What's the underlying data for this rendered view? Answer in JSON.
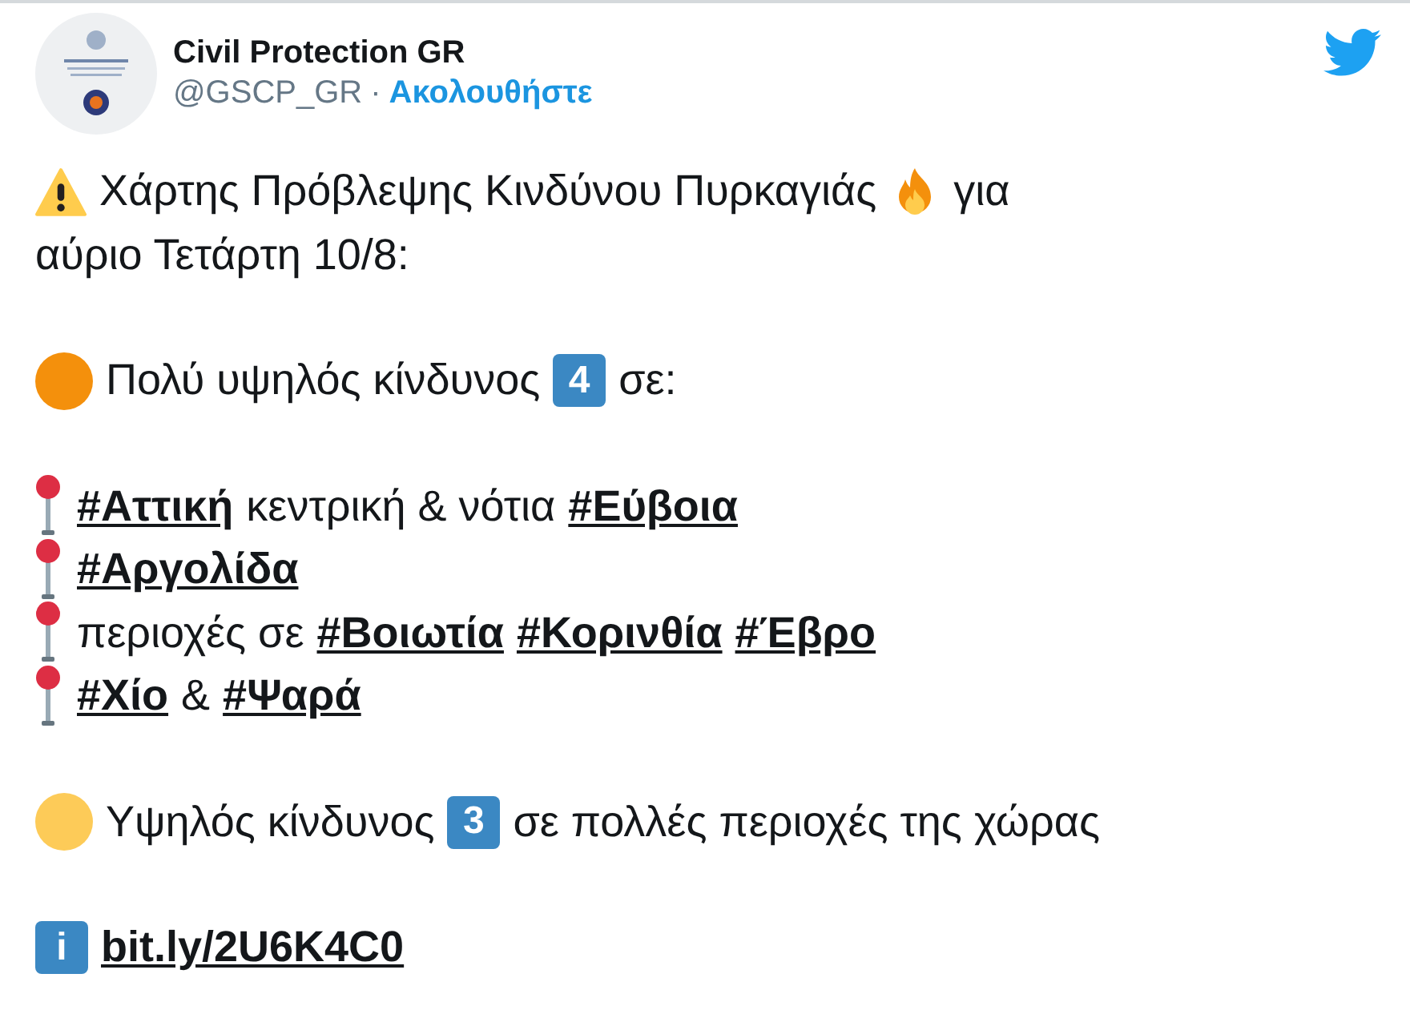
{
  "author": {
    "name": "Civil Protection GR",
    "handle": "@GSCP_GR",
    "separator": "·",
    "follow": "Ακολουθήστε"
  },
  "paragraphs": [
    [
      [
        {
          "kind": "warning"
        },
        {
          "kind": "text",
          "text": "Χάρτης Πρόβλεψης Κινδύνου Πυρκαγιάς"
        },
        {
          "kind": "fire"
        },
        {
          "kind": "text",
          "text": "για"
        }
      ],
      [
        {
          "kind": "text",
          "text": "αύριο Τετάρτη 10/8:"
        }
      ]
    ],
    [
      [
        {
          "kind": "dot",
          "color": "#f4900c"
        },
        {
          "kind": "text",
          "text": "Πολύ υψηλός κίνδυνος"
        },
        {
          "kind": "keycap",
          "text": "4"
        },
        {
          "kind": "text",
          "text": "σε:"
        }
      ]
    ],
    [
      [
        {
          "kind": "pin"
        },
        {
          "kind": "hashtag",
          "text": "#Αττική"
        },
        {
          "kind": "text",
          "text": "κεντρική & νότια"
        },
        {
          "kind": "hashtag",
          "text": "#Εύβοια"
        }
      ],
      [
        {
          "kind": "pin"
        },
        {
          "kind": "hashtag",
          "text": "#Αργολίδα"
        }
      ],
      [
        {
          "kind": "pin"
        },
        {
          "kind": "text",
          "text": "περιοχές σε"
        },
        {
          "kind": "hashtag",
          "text": "#Βοιωτία"
        },
        {
          "kind": "hashtag",
          "text": "#Κορινθία"
        },
        {
          "kind": "hashtag",
          "text": "#Έβρο"
        }
      ],
      [
        {
          "kind": "pin"
        },
        {
          "kind": "hashtag",
          "text": "#Χίο"
        },
        {
          "kind": "text",
          "text": "&"
        },
        {
          "kind": "hashtag",
          "text": "#Ψαρά"
        }
      ]
    ],
    [
      [
        {
          "kind": "dot",
          "color": "#fdcb58"
        },
        {
          "kind": "text",
          "text": "Υψηλός κίνδυνος"
        },
        {
          "kind": "keycap",
          "text": "3"
        },
        {
          "kind": "text",
          "text": "σε πολλές περιοχές της χώρας"
        }
      ]
    ],
    [
      [
        {
          "kind": "info",
          "text": "i"
        },
        {
          "kind": "link",
          "text": "bit.ly/2U6K4C0"
        }
      ]
    ]
  ]
}
